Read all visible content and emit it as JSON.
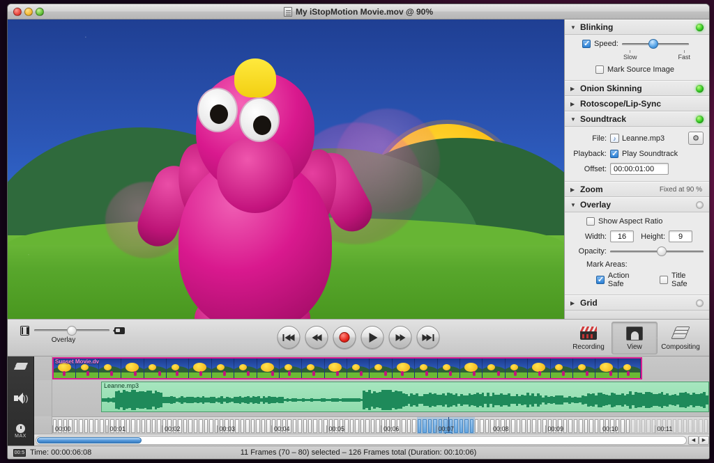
{
  "window": {
    "title": "My iStopMotion Movie.mov @ 90%",
    "title_icon": "movie-file-icon",
    "close_label": "",
    "minimize_label": "",
    "zoom_label": ""
  },
  "inspector": {
    "sections": [
      {
        "id": "blinking",
        "title": "Blinking",
        "expanded": true,
        "twisty": "▼",
        "led": "on",
        "speed_checkbox_checked": true,
        "speed_label": "Speed:",
        "slider_min_label": "Slow",
        "slider_max_label": "Fast",
        "slider_value_pct": 40,
        "mark_source_label": "Mark Source Image",
        "mark_source_checked": false
      },
      {
        "id": "onion-skinning",
        "title": "Onion Skinning",
        "expanded": false,
        "twisty": "▶",
        "led": "on"
      },
      {
        "id": "rotoscope-lipsync",
        "title": "Rotoscope/Lip-Sync",
        "expanded": false,
        "twisty": "▶",
        "led": "none"
      },
      {
        "id": "soundtrack",
        "title": "Soundtrack",
        "expanded": true,
        "twisty": "▼",
        "led": "on",
        "file_label": "File:",
        "file_value": "Leanne.mp3",
        "file_icon": "music-note-icon",
        "settings_icon": "gear-icon",
        "playback_label": "Playback:",
        "play_soundtrack_label": "Play Soundtrack",
        "play_soundtrack_checked": true,
        "offset_label": "Offset:",
        "offset_value": "00:00:01:00"
      },
      {
        "id": "zoom",
        "title": "Zoom",
        "expanded": false,
        "twisty": "▶",
        "led": "none",
        "hint": "Fixed at 90 %"
      },
      {
        "id": "overlay",
        "title": "Overlay",
        "expanded": true,
        "twisty": "▼",
        "led": "off",
        "show_aspect_label": "Show Aspect Ratio",
        "show_aspect_checked": false,
        "width_label": "Width:",
        "width_value": "16",
        "height_label": "Height:",
        "height_value": "9",
        "opacity_label": "Opacity:",
        "opacity_value_pct": 50,
        "mark_areas_label": "Mark Areas:",
        "action_safe_label": "Action Safe",
        "action_safe_checked": true,
        "title_safe_label": "Title Safe",
        "title_safe_checked": false
      },
      {
        "id": "grid",
        "title": "Grid",
        "expanded": false,
        "twisty": "▶",
        "led": "off"
      }
    ]
  },
  "transport": {
    "overlay_caption": "Overlay",
    "overlay_slider_pct": 50,
    "left_icon": "filmstrip-icon",
    "right_icon": "camera-icon",
    "buttons": [
      {
        "name": "go-to-start-button",
        "glyph": "skip-back-icon"
      },
      {
        "name": "rewind-button",
        "glyph": "rewind-icon"
      },
      {
        "name": "record-button",
        "glyph": "record-icon"
      },
      {
        "name": "play-button",
        "glyph": "play-icon"
      },
      {
        "name": "fast-forward-button",
        "glyph": "fast-forward-icon"
      },
      {
        "name": "go-to-end-button",
        "glyph": "skip-forward-icon"
      }
    ],
    "modes": [
      {
        "id": "recording",
        "label": "Recording",
        "icon": "clapperboard-icon",
        "selected": false
      },
      {
        "id": "view",
        "label": "View",
        "icon": "portrait-icon",
        "selected": true
      },
      {
        "id": "compositing",
        "label": "Compositing",
        "icon": "layers-stack-icon",
        "selected": false
      }
    ]
  },
  "timeline": {
    "track_header_icons": [
      "layers-icon",
      "speaker-icon",
      "clock-icon"
    ],
    "max_label": "MAX",
    "video_clip_label": "Sunset Movie.dv",
    "audio_clip_label": "Leanne.mp3",
    "time_labels": [
      "00:00",
      "00:01",
      "00:02",
      "00:03",
      "00:04",
      "00:05",
      "00:06",
      "00:07",
      "00:08",
      "00:09",
      "00:10",
      "00:11"
    ],
    "total_frames": 126,
    "selection_start_frame": 70,
    "selection_end_frame": 80,
    "playhead_frame": 76,
    "scroll_left_icon": "scroll-left-icon",
    "scroll_right_icon": "scroll-right-icon"
  },
  "status": {
    "time_icon": "timecode-icon",
    "time_icon_label": "00:5",
    "time_label": "Time: 00:00:06:08",
    "selection_info": "11 Frames (70 – 80) selected – 126 Frames total (Duration: 00:10:06)"
  },
  "colors": {
    "accent": "#2a7fd4",
    "record": "#e5231a",
    "led_on": "#33cc22",
    "clip_border": "#d81b8f",
    "audio_clip": "#8fdcad",
    "audio_wave": "#1e8a5a"
  }
}
